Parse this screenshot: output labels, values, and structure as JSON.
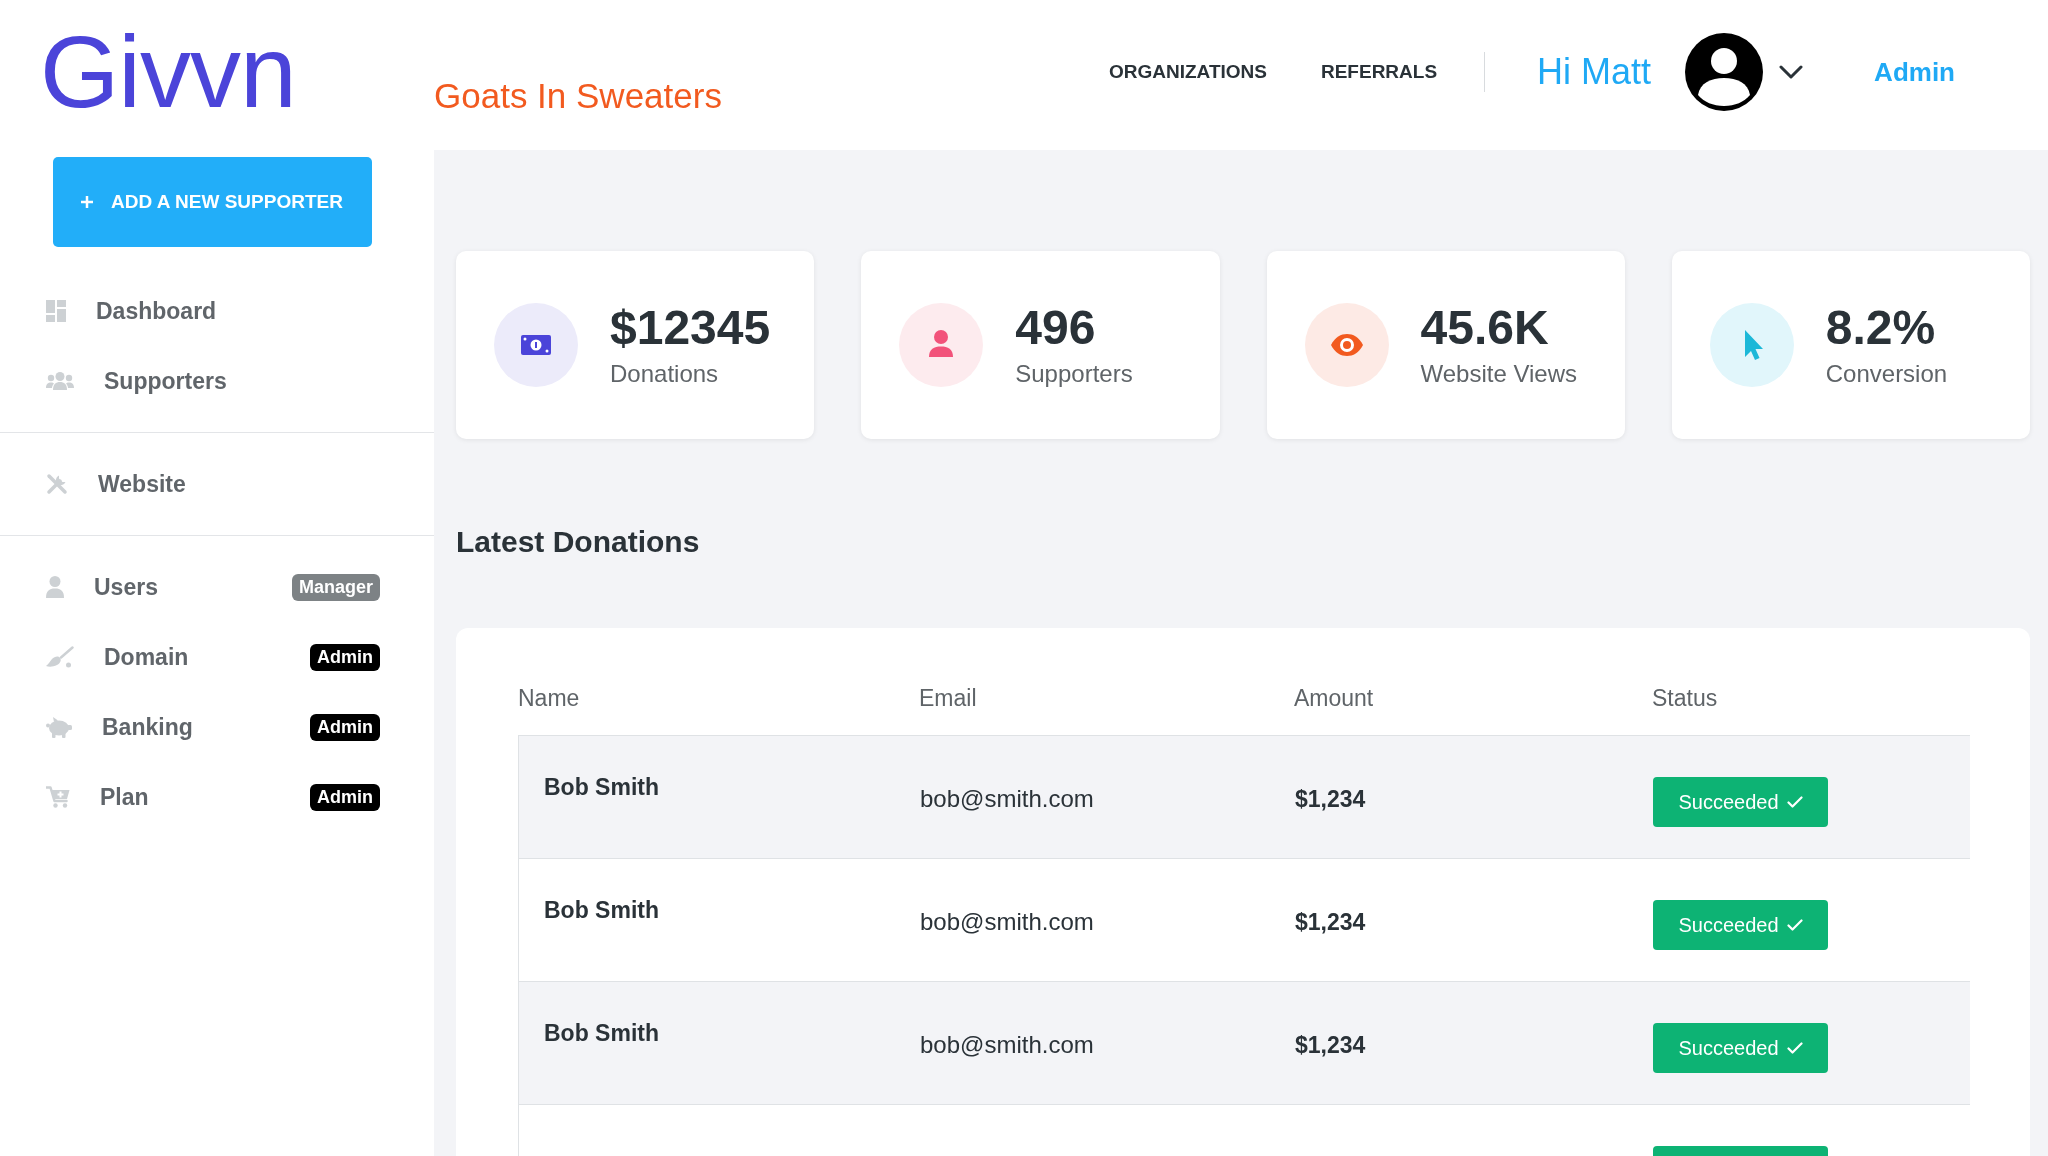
{
  "logo": {
    "text": "Givvn"
  },
  "header": {
    "organization": "Goats In Sweaters",
    "nav": [
      {
        "label": "ORGANIZATIONS"
      },
      {
        "label": "REFERRALS"
      }
    ],
    "greeting": "Hi Matt",
    "role_link": "Admin"
  },
  "sidebar": {
    "add_button": {
      "label": "ADD A NEW SUPPORTER"
    },
    "sections": [
      {
        "items": [
          {
            "label": "Dashboard"
          },
          {
            "label": "Supporters"
          }
        ]
      },
      {
        "items": [
          {
            "label": "Website"
          }
        ]
      },
      {
        "items": [
          {
            "label": "Users",
            "badge": {
              "label": "Manager",
              "color": "#7d8285"
            }
          },
          {
            "label": "Domain",
            "badge": {
              "label": "Admin",
              "color": "#000000"
            }
          },
          {
            "label": "Banking",
            "badge": {
              "label": "Admin",
              "color": "#000000"
            }
          },
          {
            "label": "Plan",
            "badge": {
              "label": "Admin",
              "color": "#000000"
            }
          }
        ]
      }
    ]
  },
  "stats": [
    {
      "value": "$12345",
      "label": "Donations"
    },
    {
      "value": "496",
      "label": "Supporters"
    },
    {
      "value": "45.6K",
      "label": "Website Views"
    },
    {
      "value": "8.2%",
      "label": "Conversion"
    }
  ],
  "latest_donations": {
    "title": "Latest Donations",
    "table": {
      "columns": [
        "Name",
        "Email",
        "Amount",
        "Status"
      ],
      "rows": [
        {
          "name": "Bob Smith",
          "email": "bob@smith.com",
          "amount": "$1,234",
          "status": {
            "label": "Succeeded",
            "kind": "success"
          }
        },
        {
          "name": "Bob Smith",
          "email": "bob@smith.com",
          "amount": "$1,234",
          "status": {
            "label": "Succeeded",
            "kind": "success"
          }
        },
        {
          "name": "Bob Smith",
          "email": "bob@smith.com",
          "amount": "$1,234",
          "status": {
            "label": "Succeeded",
            "kind": "success"
          }
        },
        {
          "status": {
            "kind": "success"
          }
        }
      ]
    }
  }
}
